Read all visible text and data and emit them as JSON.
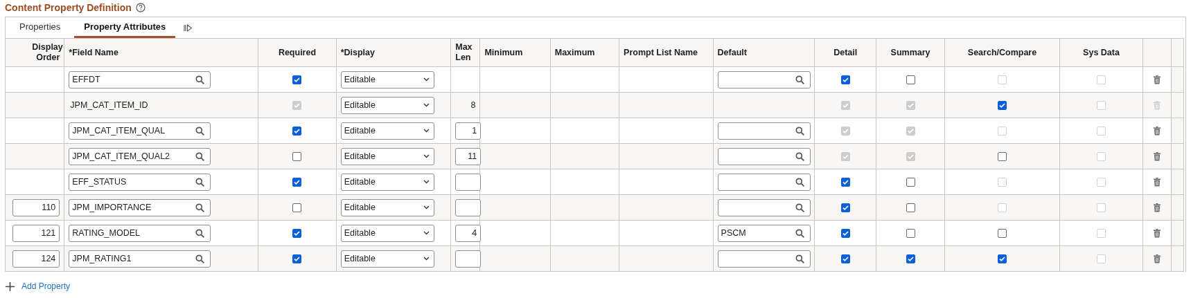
{
  "title": "Content Property Definition",
  "tabs": [
    {
      "label": "Properties",
      "selected": false
    },
    {
      "label": "Property Attributes",
      "selected": true
    }
  ],
  "columns": [
    "Display Order",
    "*Field Name",
    "Required",
    "*Display",
    "Max Len",
    "Minimum",
    "Maximum",
    "Prompt List Name",
    "Default",
    "Detail",
    "Summary",
    "Search/Compare",
    "Sys Data"
  ],
  "rows": [
    {
      "field_name": {
        "kind": "lookup",
        "value": "EFFDT"
      },
      "required": {
        "checked": true,
        "disabled": false
      },
      "display": "Editable",
      "default": {
        "kind": "lookup"
      },
      "detail": {
        "checked": true,
        "disabled": false
      },
      "summary": {
        "checked": false,
        "disabled": false
      },
      "search_compare": {
        "checked": false,
        "disabled": true
      },
      "sys_data": {
        "checked": false,
        "disabled": true
      },
      "delete": {
        "disabled": false
      }
    },
    {
      "field_name": {
        "kind": "text",
        "value": "JPM_CAT_ITEM_ID"
      },
      "required": {
        "checked": true,
        "disabled": true
      },
      "display": "Editable",
      "max_len": {
        "kind": "text",
        "value": "8"
      },
      "detail": {
        "checked": true,
        "disabled": true
      },
      "summary": {
        "checked": true,
        "disabled": true
      },
      "search_compare": {
        "checked": true,
        "disabled": false
      },
      "sys_data": {
        "checked": false,
        "disabled": true
      },
      "delete": {
        "disabled": true
      }
    },
    {
      "field_name": {
        "kind": "lookup",
        "value": "JPM_CAT_ITEM_QUAL"
      },
      "required": {
        "checked": true,
        "disabled": false
      },
      "display": "Editable",
      "max_len": {
        "kind": "field",
        "value": "1"
      },
      "default": {
        "kind": "lookup"
      },
      "detail": {
        "checked": true,
        "disabled": true
      },
      "summary": {
        "checked": true,
        "disabled": true
      },
      "search_compare": {
        "checked": false,
        "disabled": true
      },
      "sys_data": {
        "checked": false,
        "disabled": true
      },
      "delete": {
        "disabled": false
      }
    },
    {
      "field_name": {
        "kind": "lookup",
        "value": "JPM_CAT_ITEM_QUAL2"
      },
      "required": {
        "checked": false,
        "disabled": false
      },
      "display": "Editable",
      "max_len": {
        "kind": "field",
        "value": "11"
      },
      "default": {
        "kind": "lookup"
      },
      "detail": {
        "checked": true,
        "disabled": true
      },
      "summary": {
        "checked": true,
        "disabled": true
      },
      "search_compare": {
        "checked": false,
        "disabled": false
      },
      "sys_data": {
        "checked": false,
        "disabled": true
      },
      "delete": {
        "disabled": false
      }
    },
    {
      "field_name": {
        "kind": "lookup",
        "value": "EFF_STATUS"
      },
      "required": {
        "checked": true,
        "disabled": false
      },
      "display": "Editable",
      "max_len": {
        "kind": "field"
      },
      "default": {
        "kind": "lookup"
      },
      "detail": {
        "checked": true,
        "disabled": false
      },
      "summary": {
        "checked": false,
        "disabled": false
      },
      "search_compare": {
        "checked": false,
        "disabled": true
      },
      "sys_data": {
        "checked": false,
        "disabled": true
      },
      "delete": {
        "disabled": false
      }
    },
    {
      "display_order": "110",
      "field_name": {
        "kind": "lookup",
        "value": "JPM_IMPORTANCE"
      },
      "required": {
        "checked": false,
        "disabled": false
      },
      "display": "Editable",
      "max_len": {
        "kind": "field"
      },
      "default": {
        "kind": "lookup"
      },
      "detail": {
        "checked": true,
        "disabled": false
      },
      "summary": {
        "checked": false,
        "disabled": false
      },
      "search_compare": {
        "checked": false,
        "disabled": true
      },
      "sys_data": {
        "checked": false,
        "disabled": true
      },
      "delete": {
        "disabled": false
      }
    },
    {
      "display_order": "121",
      "field_name": {
        "kind": "lookup",
        "value": "RATING_MODEL"
      },
      "required": {
        "checked": true,
        "disabled": false
      },
      "display": "Editable",
      "max_len": {
        "kind": "field",
        "value": "4"
      },
      "default": {
        "kind": "lookup",
        "value": "PSCM"
      },
      "detail": {
        "checked": true,
        "disabled": false
      },
      "summary": {
        "checked": false,
        "disabled": false
      },
      "search_compare": {
        "checked": false,
        "disabled": false
      },
      "sys_data": {
        "checked": false,
        "disabled": true
      },
      "delete": {
        "disabled": false
      }
    },
    {
      "display_order": "124",
      "field_name": {
        "kind": "lookup",
        "value": "JPM_RATING1"
      },
      "required": {
        "checked": true,
        "disabled": false
      },
      "display": "Editable",
      "max_len": {
        "kind": "field"
      },
      "default": {
        "kind": "lookup"
      },
      "detail": {
        "checked": true,
        "disabled": false
      },
      "summary": {
        "checked": true,
        "disabled": false
      },
      "search_compare": {
        "checked": true,
        "disabled": false
      },
      "sys_data": {
        "checked": false,
        "disabled": true
      },
      "delete": {
        "disabled": false
      }
    }
  ],
  "add_link": "Add Property"
}
